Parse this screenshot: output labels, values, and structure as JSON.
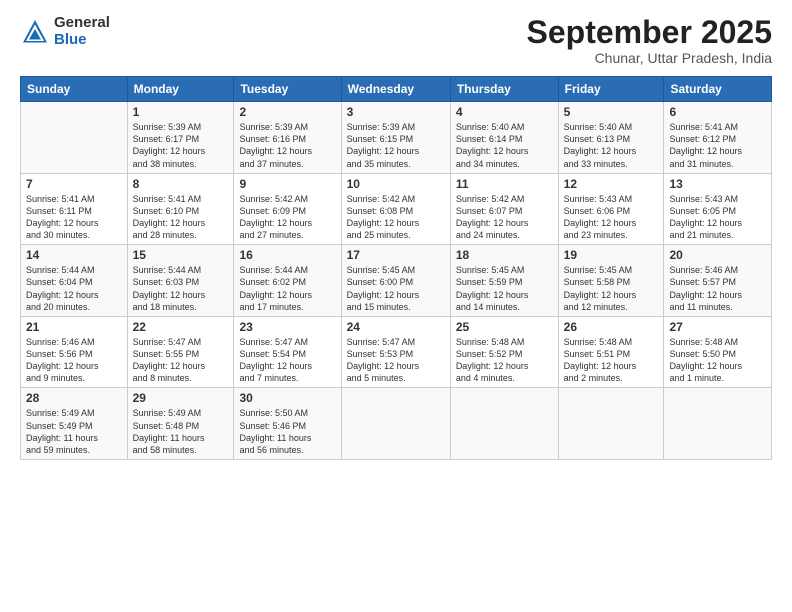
{
  "header": {
    "logo_general": "General",
    "logo_blue": "Blue",
    "month_title": "September 2025",
    "subtitle": "Chunar, Uttar Pradesh, India"
  },
  "days_of_week": [
    "Sunday",
    "Monday",
    "Tuesday",
    "Wednesday",
    "Thursday",
    "Friday",
    "Saturday"
  ],
  "weeks": [
    [
      {
        "day": "",
        "content": ""
      },
      {
        "day": "1",
        "content": "Sunrise: 5:39 AM\nSunset: 6:17 PM\nDaylight: 12 hours\nand 38 minutes."
      },
      {
        "day": "2",
        "content": "Sunrise: 5:39 AM\nSunset: 6:16 PM\nDaylight: 12 hours\nand 37 minutes."
      },
      {
        "day": "3",
        "content": "Sunrise: 5:39 AM\nSunset: 6:15 PM\nDaylight: 12 hours\nand 35 minutes."
      },
      {
        "day": "4",
        "content": "Sunrise: 5:40 AM\nSunset: 6:14 PM\nDaylight: 12 hours\nand 34 minutes."
      },
      {
        "day": "5",
        "content": "Sunrise: 5:40 AM\nSunset: 6:13 PM\nDaylight: 12 hours\nand 33 minutes."
      },
      {
        "day": "6",
        "content": "Sunrise: 5:41 AM\nSunset: 6:12 PM\nDaylight: 12 hours\nand 31 minutes."
      }
    ],
    [
      {
        "day": "7",
        "content": "Sunrise: 5:41 AM\nSunset: 6:11 PM\nDaylight: 12 hours\nand 30 minutes."
      },
      {
        "day": "8",
        "content": "Sunrise: 5:41 AM\nSunset: 6:10 PM\nDaylight: 12 hours\nand 28 minutes."
      },
      {
        "day": "9",
        "content": "Sunrise: 5:42 AM\nSunset: 6:09 PM\nDaylight: 12 hours\nand 27 minutes."
      },
      {
        "day": "10",
        "content": "Sunrise: 5:42 AM\nSunset: 6:08 PM\nDaylight: 12 hours\nand 25 minutes."
      },
      {
        "day": "11",
        "content": "Sunrise: 5:42 AM\nSunset: 6:07 PM\nDaylight: 12 hours\nand 24 minutes."
      },
      {
        "day": "12",
        "content": "Sunrise: 5:43 AM\nSunset: 6:06 PM\nDaylight: 12 hours\nand 23 minutes."
      },
      {
        "day": "13",
        "content": "Sunrise: 5:43 AM\nSunset: 6:05 PM\nDaylight: 12 hours\nand 21 minutes."
      }
    ],
    [
      {
        "day": "14",
        "content": "Sunrise: 5:44 AM\nSunset: 6:04 PM\nDaylight: 12 hours\nand 20 minutes."
      },
      {
        "day": "15",
        "content": "Sunrise: 5:44 AM\nSunset: 6:03 PM\nDaylight: 12 hours\nand 18 minutes."
      },
      {
        "day": "16",
        "content": "Sunrise: 5:44 AM\nSunset: 6:02 PM\nDaylight: 12 hours\nand 17 minutes."
      },
      {
        "day": "17",
        "content": "Sunrise: 5:45 AM\nSunset: 6:00 PM\nDaylight: 12 hours\nand 15 minutes."
      },
      {
        "day": "18",
        "content": "Sunrise: 5:45 AM\nSunset: 5:59 PM\nDaylight: 12 hours\nand 14 minutes."
      },
      {
        "day": "19",
        "content": "Sunrise: 5:45 AM\nSunset: 5:58 PM\nDaylight: 12 hours\nand 12 minutes."
      },
      {
        "day": "20",
        "content": "Sunrise: 5:46 AM\nSunset: 5:57 PM\nDaylight: 12 hours\nand 11 minutes."
      }
    ],
    [
      {
        "day": "21",
        "content": "Sunrise: 5:46 AM\nSunset: 5:56 PM\nDaylight: 12 hours\nand 9 minutes."
      },
      {
        "day": "22",
        "content": "Sunrise: 5:47 AM\nSunset: 5:55 PM\nDaylight: 12 hours\nand 8 minutes."
      },
      {
        "day": "23",
        "content": "Sunrise: 5:47 AM\nSunset: 5:54 PM\nDaylight: 12 hours\nand 7 minutes."
      },
      {
        "day": "24",
        "content": "Sunrise: 5:47 AM\nSunset: 5:53 PM\nDaylight: 12 hours\nand 5 minutes."
      },
      {
        "day": "25",
        "content": "Sunrise: 5:48 AM\nSunset: 5:52 PM\nDaylight: 12 hours\nand 4 minutes."
      },
      {
        "day": "26",
        "content": "Sunrise: 5:48 AM\nSunset: 5:51 PM\nDaylight: 12 hours\nand 2 minutes."
      },
      {
        "day": "27",
        "content": "Sunrise: 5:48 AM\nSunset: 5:50 PM\nDaylight: 12 hours\nand 1 minute."
      }
    ],
    [
      {
        "day": "28",
        "content": "Sunrise: 5:49 AM\nSunset: 5:49 PM\nDaylight: 11 hours\nand 59 minutes."
      },
      {
        "day": "29",
        "content": "Sunrise: 5:49 AM\nSunset: 5:48 PM\nDaylight: 11 hours\nand 58 minutes."
      },
      {
        "day": "30",
        "content": "Sunrise: 5:50 AM\nSunset: 5:46 PM\nDaylight: 11 hours\nand 56 minutes."
      },
      {
        "day": "",
        "content": ""
      },
      {
        "day": "",
        "content": ""
      },
      {
        "day": "",
        "content": ""
      },
      {
        "day": "",
        "content": ""
      }
    ]
  ]
}
